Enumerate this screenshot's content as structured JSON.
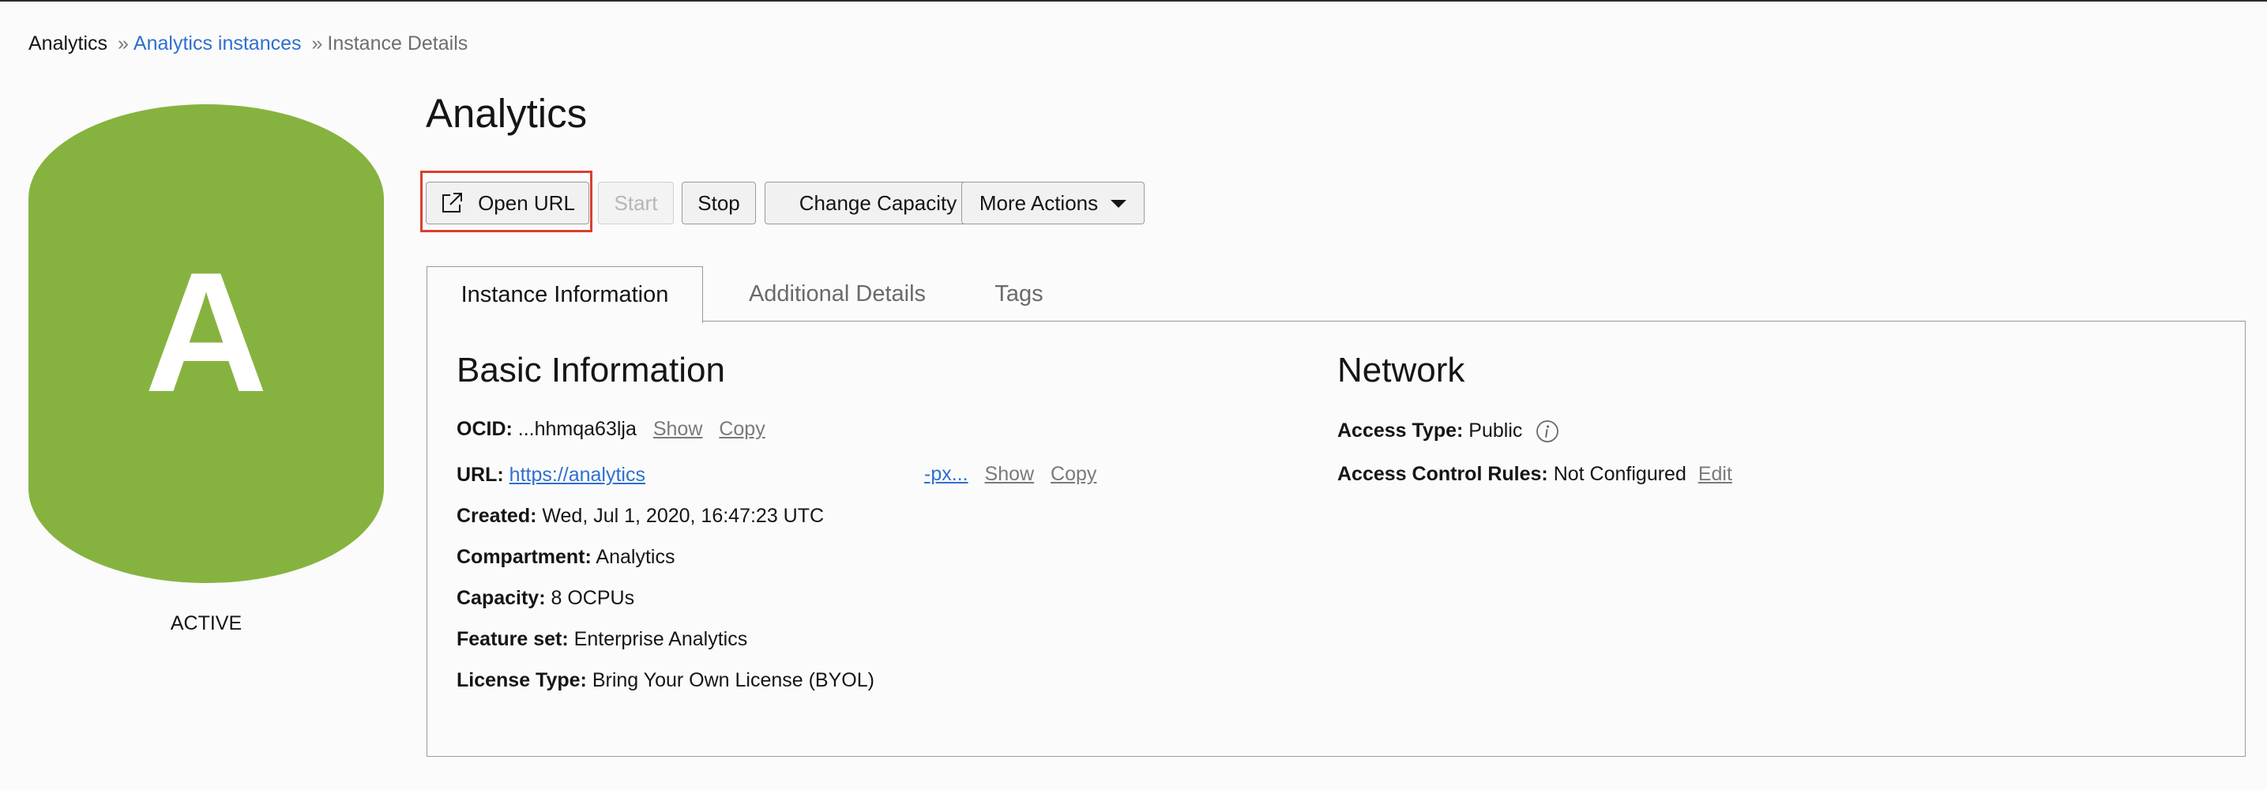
{
  "breadcrumb": {
    "root": "Analytics",
    "separator": "»",
    "link": "Analytics instances",
    "current": "Instance Details"
  },
  "instance": {
    "icon_letter": "A",
    "icon_color": "#86b33f",
    "status": "ACTIVE",
    "title": "Analytics"
  },
  "toolbar": {
    "open_url": "Open URL",
    "start": "Start",
    "stop": "Stop",
    "change_capacity": "Change Capacity",
    "more_actions": "More Actions",
    "highlight_color": "#d9402f"
  },
  "tabs": [
    {
      "label": "Instance Information",
      "active": true
    },
    {
      "label": "Additional Details",
      "active": false
    },
    {
      "label": "Tags",
      "active": false
    }
  ],
  "basic_info": {
    "title": "Basic Information",
    "ocid_label": "OCID:",
    "ocid_value": "...hhmqa63lja",
    "ocid_show": "Show",
    "ocid_copy": "Copy",
    "url_label": "URL:",
    "url_value_start": "https://analytics",
    "url_value_end": "-px...",
    "url_show": "Show",
    "url_copy": "Copy",
    "created_label": "Created:",
    "created_value": "Wed, Jul 1, 2020, 16:47:23 UTC",
    "compartment_label": "Compartment:",
    "compartment_value": "Analytics",
    "capacity_label": "Capacity:",
    "capacity_value": "8 OCPUs",
    "feature_label": "Feature set:",
    "feature_value": "Enterprise Analytics",
    "license_label": "License Type:",
    "license_value": "Bring Your Own License (BYOL)"
  },
  "network": {
    "title": "Network",
    "access_type_label": "Access Type:",
    "access_type_value": "Public",
    "access_rules_label": "Access Control Rules:",
    "access_rules_value": "Not Configured",
    "access_rules_edit": "Edit"
  }
}
